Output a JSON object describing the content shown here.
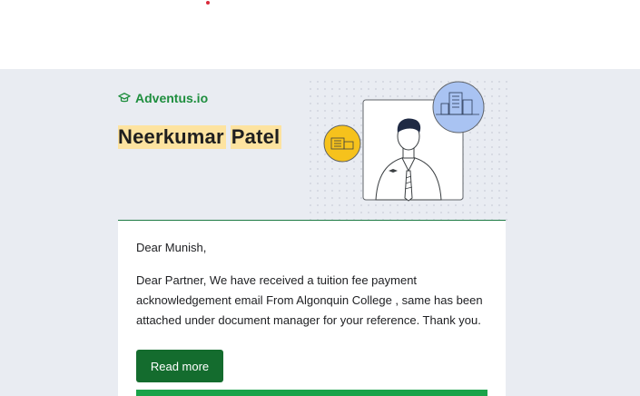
{
  "header": {
    "brand_name": "Adventus.io",
    "recipient_first": "Neerkumar",
    "recipient_last": "Patel",
    "brand_color": "#1e8e3e",
    "highlight_color": "#fde3a0"
  },
  "email": {
    "greeting": "Dear Munish,",
    "body": "Dear Partner, We have received a tuition fee payment acknowledgement email From Algonquin College , same has been attached under document manager for your reference. Thank you.",
    "cta_label": "Read more",
    "cta_color": "#146c2e",
    "accent_bar_color": "#1aa34a"
  },
  "icons": [
    "graduation-cap-icon",
    "student-illustration",
    "building-badge-icon",
    "city-badge-icon"
  ]
}
